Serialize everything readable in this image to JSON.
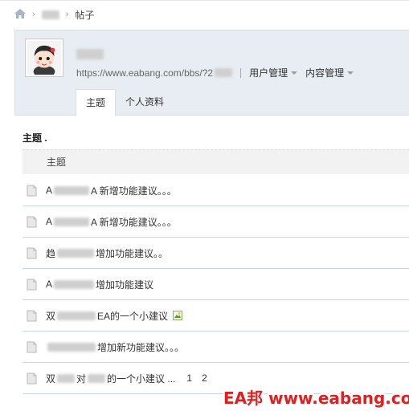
{
  "breadcrumb": {
    "current": "帖子"
  },
  "profile": {
    "url": "https://www.eabang.com/bbs/?2",
    "menus": [
      "用户管理",
      "内容管理"
    ]
  },
  "tabs": [
    {
      "label": "主题",
      "active": true
    },
    {
      "label": "个人资料",
      "active": false
    }
  ],
  "section_title": "主题 .",
  "list_header": "主题",
  "rows": [
    {
      "prefix": "A",
      "suffix": "A 新增功能建议。。。"
    },
    {
      "prefix": "A",
      "suffix": "A 新增功能建议。。。"
    },
    {
      "prefix": "趋",
      "suffix": "增加功能建议。。"
    },
    {
      "prefix": "A",
      "suffix": "增加功能建议"
    },
    {
      "prefix": "双",
      "suffix": "EA的一个小建议"
    },
    {
      "prefix": "",
      "suffix": "增加新功能建议。。。"
    },
    {
      "prefix": "双",
      "suffix": "的一个小建议 ...",
      "mid": "对",
      "pages": [
        "1",
        "2"
      ]
    }
  ],
  "watermark": "EA邦 www.eabang.com",
  "colors": {
    "header_bg": "#e8edf3",
    "row_border": "#c5d6e8",
    "watermark": "#e02020"
  }
}
